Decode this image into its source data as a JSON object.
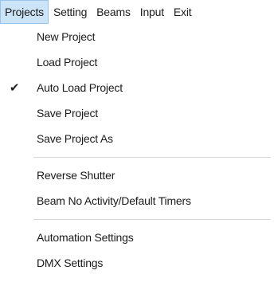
{
  "menubar": {
    "items": [
      {
        "label": "Projects",
        "active": true
      },
      {
        "label": "Setting",
        "active": false
      },
      {
        "label": "Beams",
        "active": false
      },
      {
        "label": "Input",
        "active": false
      },
      {
        "label": "Exit",
        "active": false
      }
    ]
  },
  "dropdown": {
    "items": [
      {
        "label": "New Project",
        "checked": false
      },
      {
        "label": "Load Project",
        "checked": false
      },
      {
        "label": "Auto Load Project",
        "checked": true,
        "check_glyph": "✔"
      },
      {
        "label": "Save Project",
        "checked": false
      },
      {
        "label": "Save Project As",
        "checked": false
      },
      {
        "label": "Reverse Shutter",
        "checked": false
      },
      {
        "label": "Beam No Activity/Default Timers",
        "checked": false
      },
      {
        "label": "Automation Settings",
        "checked": false
      },
      {
        "label": "DMX Settings",
        "checked": false
      }
    ]
  },
  "colors": {
    "active_menu_bg": "#cce4f7",
    "active_menu_border": "#99c3e8",
    "separator": "#d7d7d7"
  }
}
